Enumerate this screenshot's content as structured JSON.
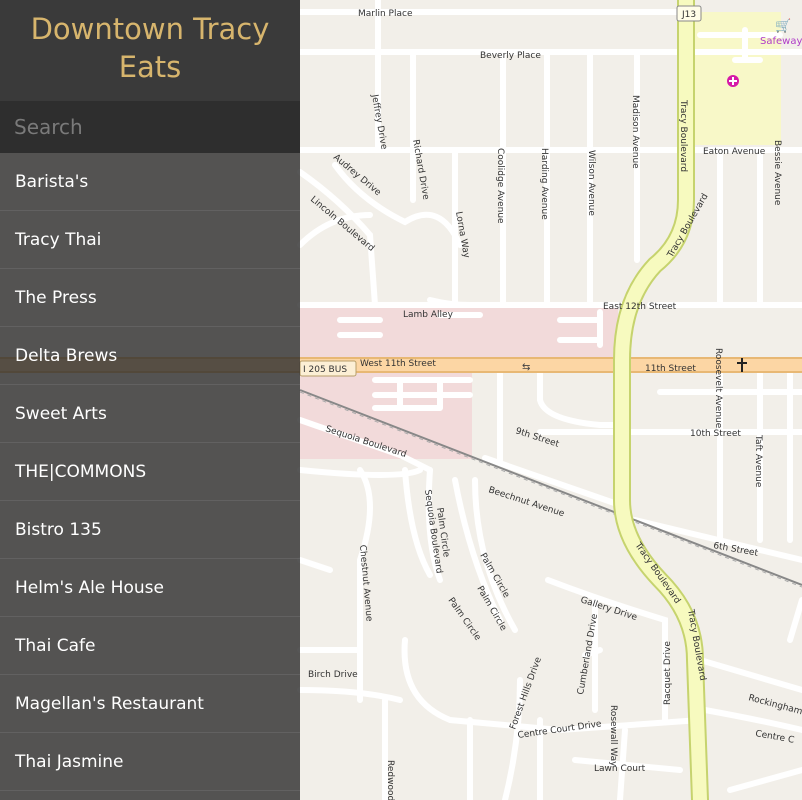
{
  "app": {
    "title_line1": "Downtown Tracy",
    "title_line2": "Eats"
  },
  "search": {
    "placeholder": "Search"
  },
  "restaurants": [
    "Barista's",
    "Tracy Thai",
    "The Press",
    "Delta Brews",
    "Sweet Arts",
    "THE|COMMONS",
    "Bistro 135",
    "Helm's Ale House",
    "Thai Cafe",
    "Magellan's Restaurant",
    "Thai Jasmine"
  ],
  "map": {
    "streets": {
      "marlin": "Marlin Place",
      "beverly": "Beverly Place",
      "jeffrey": "Jeffrey Drive",
      "richard": "Richard Drive",
      "audrey": "Audrey Drive",
      "lincoln": "Lincoln Boulevard",
      "lorna": "Lorna Way",
      "coolidge": "Coolidge Avenue",
      "harding": "Harding Avenue",
      "wilson": "Wilson Avenue",
      "madison": "Madison Avenue",
      "tracy_blvd": "Tracy Boulevard",
      "eaton": "Eaton Avenue",
      "besse": "Bessie Avenue",
      "e12th": "East 12th Street",
      "lamb": "Lamb Alley",
      "w11th": "West 11th Street",
      "i205": "I 205 BUS",
      "e11th": "11th Street",
      "roosevelt": "Roosevelt Avenue",
      "tenth": "10th Street",
      "taft": "Taft Avenue",
      "ninth": "9th Street",
      "sequoia_blvd": "Sequoia Boulevard",
      "beechnut": "Beechnut Avenue",
      "sixth": "6th Street",
      "palm": "Palm Circle",
      "chestnut": "Chestnut Avenue",
      "gallery": "Gallery Drive",
      "cumberland": "Cumberland Drive",
      "racquet": "Racquet Drive",
      "forest": "Forest Hills Drive",
      "birch": "Birch Drive",
      "centre": "Centre Court Drive",
      "rosewall": "Rosewall Way",
      "lawn": "Lawn Court",
      "redwood": "Redwood",
      "rockingham": "Rockingham",
      "centre_short": "Centre C",
      "j13": "J13",
      "safeway": "Safeway"
    }
  }
}
